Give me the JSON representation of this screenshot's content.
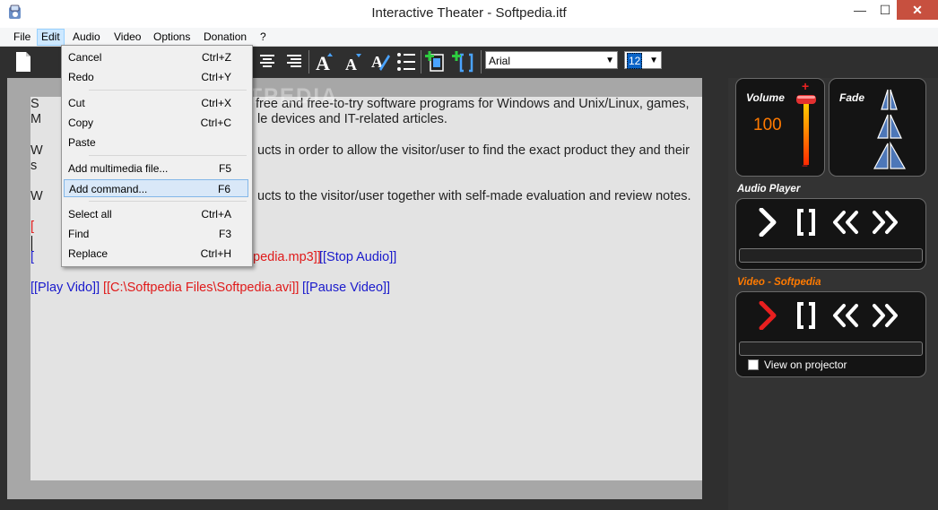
{
  "window": {
    "title": "Interactive Theater - Softpedia.itf",
    "minimize": "—",
    "maximize": "☐",
    "close": "✕"
  },
  "menubar": {
    "items": [
      "File",
      "Edit",
      "Audio",
      "Video",
      "Options",
      "Donation",
      "?"
    ]
  },
  "edit_menu": {
    "items": [
      {
        "label": "Cancel",
        "shortcut": "Ctrl+Z"
      },
      {
        "label": "Redo",
        "shortcut": "Ctrl+Y"
      },
      {
        "label": "Cut",
        "shortcut": "Ctrl+X"
      },
      {
        "label": "Copy",
        "shortcut": "Ctrl+C"
      },
      {
        "label": "Paste",
        "shortcut": ""
      },
      {
        "label": "Add multimedia file...",
        "shortcut": "F5"
      },
      {
        "label": "Add command...",
        "shortcut": "F6"
      },
      {
        "label": "Select all",
        "shortcut": "Ctrl+A"
      },
      {
        "label": "Find",
        "shortcut": "F3"
      },
      {
        "label": "Replace",
        "shortcut": "Ctrl+H"
      }
    ],
    "highlighted": "Add command..."
  },
  "toolbar": {
    "font": "Arial",
    "size": "12",
    "dropdown_arrow": "▼"
  },
  "editor": {
    "line1_start": "S",
    "line1_end": " free and free-to-try software programs for Windows and Unix/Linux, games,",
    "line2_start": "M",
    "line2_end": "le devices and IT-related articles.",
    "line3_start": "W",
    "line3_end": "ucts in order to allow the visitor/user to find the exact product they and their",
    "line4_start": "s",
    "line5_start": "W",
    "line5_end": "ucts to the visitor/user together with self-made evaluation and review notes.",
    "line6_start": "[",
    "line7_start": "[",
    "line7_red": "pedia.mp3]]",
    "line7_blue": "[[Stop Audio]]",
    "line8_play": "[[Play Vido]]",
    "line8_file": "[[C:\\Softpedia Files\\Softpedia.avi]]",
    "line8_pause": "[[Pause Video]]"
  },
  "volume": {
    "label": "Volume",
    "value": "100",
    "plus": "+",
    "minus": "−"
  },
  "fade": {
    "label": "Fade"
  },
  "audio_player": {
    "label": "Audio Player"
  },
  "video_player": {
    "label": "Video - Softpedia",
    "checkbox_label": "View on projector",
    "checked": false
  },
  "colors": {
    "accent_orange": "#ff6a00",
    "link_blue": "#1a1acc",
    "file_red": "#e01a1a"
  }
}
